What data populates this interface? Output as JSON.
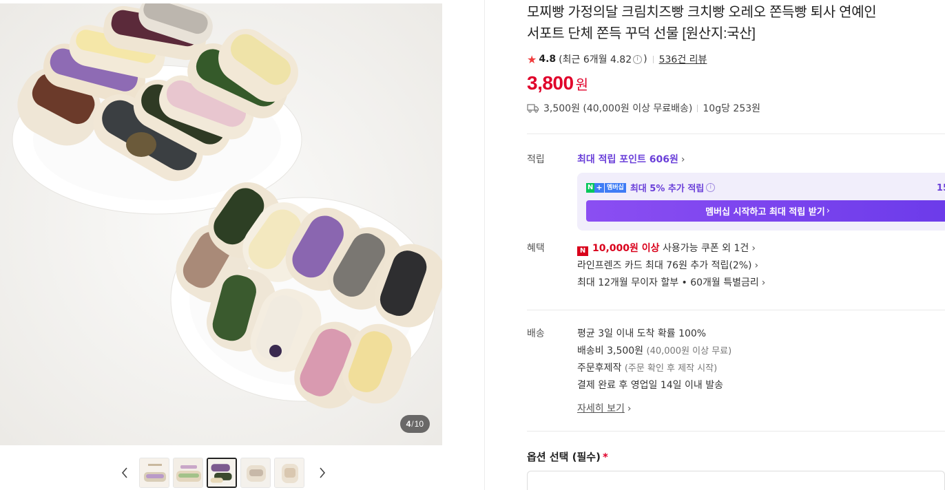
{
  "gallery": {
    "counter_current": "4",
    "counter_total": "10",
    "thumbnails": [
      {
        "name": "thumb-1",
        "active": false
      },
      {
        "name": "thumb-2",
        "active": false
      },
      {
        "name": "thumb-3",
        "active": true
      },
      {
        "name": "thumb-4",
        "active": false
      },
      {
        "name": "thumb-5",
        "active": false
      }
    ]
  },
  "product": {
    "title_line1": "모찌빵 가정의달 크림치즈빵 크치빵 오레오 쫀득빵 퇴사 연예인",
    "title_line2": "서포트 단체 쫀득 꾸덕 선물 [원산지:국산]",
    "rating": "4.8",
    "rating_detail_prefix": "(최근 6개월 4.82",
    "rating_detail_suffix": ")",
    "review_count": "536건 리뷰",
    "price": "3,800",
    "price_unit": "원",
    "shipping": "3,500원 (40,000원 이상 무료배송)",
    "unit_price": "10g당 253원"
  },
  "points": {
    "label": "적립",
    "title_prefix": "최대 적립 포인트",
    "amount": "606원",
    "member_text": "최대 5% 추가 적립",
    "member_right": "15",
    "badge_n": "N",
    "badge_plus": "+",
    "badge_m": "멤버십",
    "button": "멤버십 시작하고 최대 적립 받기"
  },
  "benefits": {
    "label": "혜택",
    "badge": "N",
    "coupon_amount": "10,000원 이상",
    "coupon_text": "사용가능 쿠폰 외 1건",
    "card_text": "라인프렌즈 카드 최대 76원 추가 적립(2%)",
    "installment_text": "최대 12개월 무이자 할부 • 60개월 특별금리"
  },
  "delivery": {
    "label": "배송",
    "line1": "평균 3일 이내 도착 확률 100%",
    "line2_main": "배송비 3,500원",
    "line2_sub": "(40,000원 이상 무료)",
    "line3_main": "주문후제작",
    "line3_sub": "(주문 확인 후 제작 시작)",
    "line4": "결제 완료 후 영업일 14일 이내 발송",
    "detail_link": "자세히 보기"
  },
  "options": {
    "title": "옵션 선택 (필수)",
    "required_mark": "*"
  },
  "colors": {
    "price_red": "#e0002a",
    "accent_purple": "#6a3fd9",
    "membership_bg": "#f1eefb",
    "star": "#f03c3c"
  }
}
